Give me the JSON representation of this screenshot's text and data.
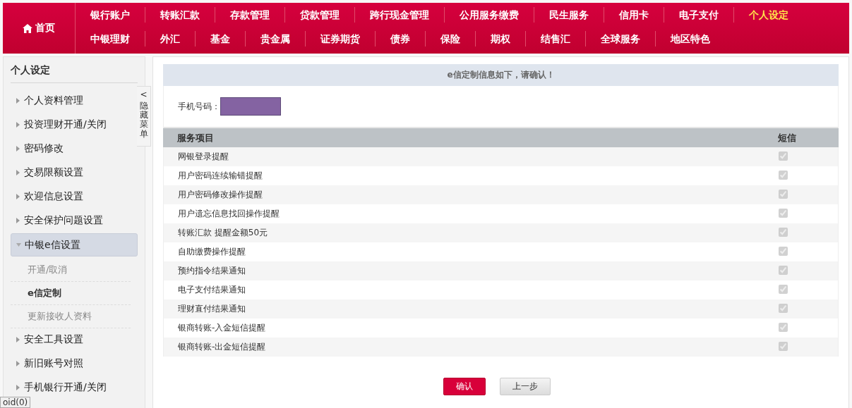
{
  "nav": {
    "home": "首页",
    "top_links": [
      {
        "label": "银行账户",
        "selected": false
      },
      {
        "label": "转账汇款",
        "selected": false
      },
      {
        "label": "存款管理",
        "selected": false
      },
      {
        "label": "贷款管理",
        "selected": false
      },
      {
        "label": "跨行现金管理",
        "selected": false
      },
      {
        "label": "公用服务缴费",
        "selected": false
      },
      {
        "label": "民生服务",
        "selected": false
      },
      {
        "label": "信用卡",
        "selected": false
      },
      {
        "label": "电子支付",
        "selected": false
      },
      {
        "label": "个人设定",
        "selected": true
      }
    ],
    "bottom_links": [
      {
        "label": "中银理财",
        "selected": false
      },
      {
        "label": "外汇",
        "selected": false
      },
      {
        "label": "基金",
        "selected": false
      },
      {
        "label": "贵金属",
        "selected": false
      },
      {
        "label": "证券期货",
        "selected": false
      },
      {
        "label": "债券",
        "selected": false
      },
      {
        "label": "保险",
        "selected": false
      },
      {
        "label": "期权",
        "selected": false
      },
      {
        "label": "结售汇",
        "selected": false
      },
      {
        "label": "全球服务",
        "selected": false
      },
      {
        "label": "地区特色",
        "selected": false
      }
    ]
  },
  "sidebar": {
    "title": "个人设定",
    "hide_tab": {
      "arrow": "<",
      "label": "隐藏菜单"
    },
    "items": [
      {
        "label": "个人资料管理",
        "expanded": false
      },
      {
        "label": "投资理财开通/关闭",
        "expanded": false
      },
      {
        "label": "密码修改",
        "expanded": false
      },
      {
        "label": "交易限额设置",
        "expanded": false
      },
      {
        "label": "欢迎信息设置",
        "expanded": false
      },
      {
        "label": "安全保护问题设置",
        "expanded": false
      },
      {
        "label": "中银e信设置",
        "expanded": true,
        "children": [
          {
            "label": "开通/取消",
            "selected": false
          },
          {
            "label": "e信定制",
            "selected": true
          },
          {
            "label": "更新接收人资料",
            "selected": false
          }
        ]
      },
      {
        "label": "安全工具设置",
        "expanded": false
      },
      {
        "label": "新旧账号对照",
        "expanded": false
      },
      {
        "label": "手机银行开通/关闭",
        "expanded": false
      }
    ]
  },
  "content": {
    "title": "e信定制信息如下，请确认！",
    "phone": {
      "label": "手机号码：",
      "masked": true
    },
    "table": {
      "columns": [
        "服务项目",
        "短信"
      ],
      "rows": [
        {
          "service": "网银登录提醒",
          "sms": true
        },
        {
          "service": "用户密码连续输错提醒",
          "sms": true
        },
        {
          "service": "用户密码修改操作提醒",
          "sms": true
        },
        {
          "service": "用户遗忘信息找回操作提醒",
          "sms": true
        },
        {
          "service": "转账汇款 提醒金额50元",
          "sms": true
        },
        {
          "service": "自助缴费操作提醒",
          "sms": true
        },
        {
          "service": "预约指令结果通知",
          "sms": true
        },
        {
          "service": "电子支付结果通知",
          "sms": true
        },
        {
          "service": "理财直付结果通知",
          "sms": true
        },
        {
          "service": "银商转账-入金短信提醒",
          "sms": true
        },
        {
          "service": "银商转账-出金短信提醒",
          "sms": true
        }
      ]
    },
    "buttons": [
      {
        "label": "确认",
        "kind": "primary"
      },
      {
        "label": "上一步",
        "kind": "secondary"
      }
    ]
  },
  "status_bar": "oid(0)"
}
